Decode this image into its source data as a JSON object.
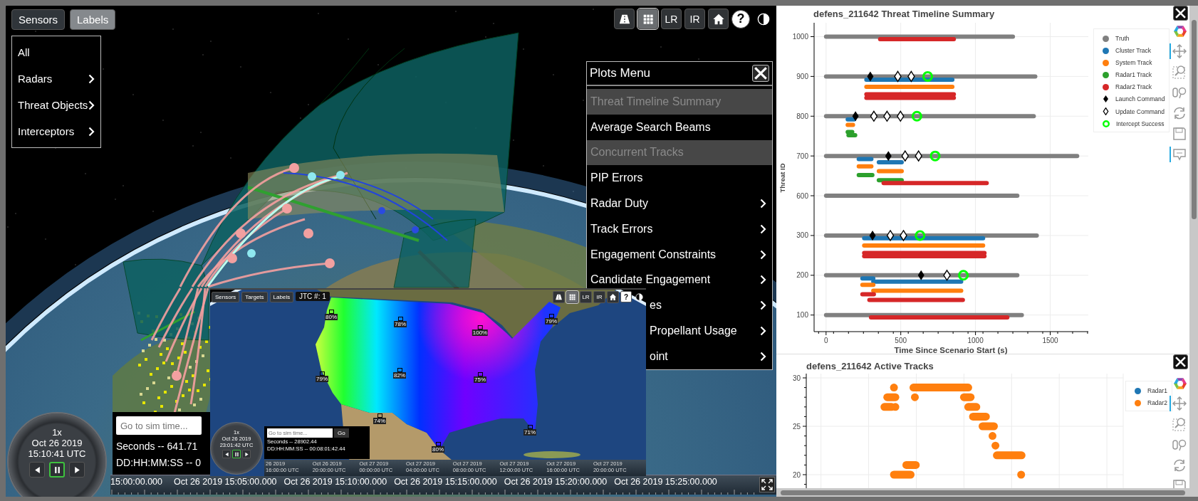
{
  "viewer": {
    "top_buttons": [
      {
        "label": "Sensors",
        "selected": false
      },
      {
        "label": "Labels",
        "selected": true
      }
    ],
    "labels_menu": [
      {
        "label": "All",
        "submenu": false
      },
      {
        "label": "Radars",
        "submenu": true
      },
      {
        "label": "Threat Objects",
        "submenu": true
      },
      {
        "label": "Interceptors",
        "submenu": true
      }
    ],
    "toolbar": [
      {
        "kind": "road",
        "selected": false
      },
      {
        "kind": "grid",
        "selected": true
      },
      {
        "kind": "text",
        "label": "LR",
        "selected": false
      },
      {
        "kind": "text",
        "label": "IR",
        "selected": false
      },
      {
        "kind": "home",
        "selected": false
      },
      {
        "kind": "round-text",
        "label": "?",
        "selected": false
      },
      {
        "kind": "contrast",
        "selected": false
      }
    ],
    "plots_menu": {
      "title": "Plots Menu",
      "items": [
        {
          "label": "Threat Timeline Summary",
          "disabled": true,
          "submenu": false,
          "covered": false
        },
        {
          "label": "Average Search Beams",
          "disabled": false,
          "submenu": false,
          "covered": false
        },
        {
          "label": "Concurrent Tracks",
          "disabled": true,
          "submenu": false,
          "covered": false
        },
        {
          "label": "PIP Errors",
          "disabled": false,
          "submenu": false,
          "covered": false
        },
        {
          "label": "Radar Duty",
          "disabled": false,
          "submenu": true,
          "covered": false
        },
        {
          "label": "Track Errors",
          "disabled": false,
          "submenu": true,
          "covered": false
        },
        {
          "label": "Engagement Constraints",
          "disabled": false,
          "submenu": true,
          "covered": false
        },
        {
          "label": "Candidate Engagement",
          "disabled": false,
          "submenu": true,
          "covered": false
        },
        {
          "label": "es",
          "disabled": false,
          "submenu": true,
          "covered": true
        },
        {
          "label": "Propellant Usage",
          "disabled": false,
          "submenu": true,
          "covered": true
        },
        {
          "label": "oint",
          "disabled": false,
          "submenu": true,
          "covered": true
        }
      ]
    },
    "clock": {
      "speed": "1x",
      "date": "Oct 26 2019",
      "time": "15:10:41 UTC",
      "controls": [
        {
          "kind": "back",
          "selected": false
        },
        {
          "kind": "pause",
          "selected": true
        },
        {
          "kind": "forward",
          "selected": false
        }
      ]
    },
    "sim_time": {
      "placeholder": "Go to sim time...",
      "seconds": "Seconds -- 641.71",
      "dhms": "DD:HH:MM:SS -- 0"
    },
    "timeline": {
      "labels": [
        "15:00:00.000",
        "Oct 26 2019 15:05:00.000",
        "Oct 26 2019 15:10:00.000",
        "Oct 26 2019 15:15:00.000",
        "Oct 26 2019 15:20:00.000",
        "Oct 26 2019 15:25:00.000"
      ]
    },
    "inset": {
      "buttons": [
        {
          "label": "Sensors",
          "selected": false
        },
        {
          "label": "Targets",
          "selected": false
        },
        {
          "label": "Labels",
          "selected": false
        }
      ],
      "jtc": "JTC #: 1",
      "toolbar": [
        {
          "kind": "road",
          "selected": false
        },
        {
          "kind": "grid",
          "selected": true
        },
        {
          "kind": "text",
          "label": "LR",
          "selected": false
        },
        {
          "kind": "text",
          "label": "IR",
          "selected": false
        },
        {
          "kind": "home",
          "selected": false
        },
        {
          "kind": "round-text",
          "label": "?",
          "selected": false
        },
        {
          "kind": "contrast",
          "selected": false
        }
      ],
      "coverage_labels": [
        "80%",
        "78%",
        "100%",
        "79%",
        "79%",
        "82%",
        "75%",
        "74%",
        "71%",
        "80%"
      ],
      "clock": {
        "speed": "1x",
        "date": "Oct 26 2019",
        "time": "23:01:42 UTC",
        "controls": [
          {
            "kind": "back",
            "selected": false
          },
          {
            "kind": "pause",
            "selected": true
          },
          {
            "kind": "forward",
            "selected": false
          }
        ]
      },
      "sim_time": {
        "placeholder": "Go to sim time...",
        "button": "Go",
        "seconds": "Seconds -- 28902.44",
        "dhms": "DD:HH:MM:SS -- 00:08:01:42.44"
      },
      "timeline": {
        "labels": [
          "26 2019 16:00:00 UTC",
          "Oct 26 2019 20:00:00 UTC",
          "Oct 27 2019 00:00:00 UTC",
          "Oct 27 2019 04:00:00 UTC",
          "Oct 27 2019 08:00:00 UTC",
          "Oct 27 2019 12:00:00 UTC",
          "Oct 27 2019 16:00:00 UTC",
          "Oct 27 2019 20:00:00 UTC"
        ]
      }
    }
  },
  "threat_timeline": {
    "title": "defens_211642 Threat Timeline Summary",
    "y_title": "Threat ID",
    "x_title": "Time Since Scenario Start (s)",
    "y_ticks": [
      "1000",
      "900",
      "800",
      "700",
      "600",
      "300",
      "200",
      "100"
    ],
    "x_ticks": [
      "0",
      "500",
      "1000",
      "1500"
    ],
    "legend": [
      {
        "label": "Truth",
        "kind": "dot",
        "color": "#808080"
      },
      {
        "label": "Cluster Track",
        "kind": "dot",
        "color": "#1f77b4"
      },
      {
        "label": "System Track",
        "kind": "dot",
        "color": "#ff7f0e"
      },
      {
        "label": "Radar1 Track",
        "kind": "dot",
        "color": "#2ca02c"
      },
      {
        "label": "Radar2 Track",
        "kind": "dot",
        "color": "#d62728"
      },
      {
        "label": "Launch Command",
        "kind": "diamond",
        "color": "#000000"
      },
      {
        "label": "Update Command",
        "kind": "open-diamond",
        "color": "#000000"
      },
      {
        "label": "Intercept Success",
        "kind": "ring",
        "color": "#00ff00"
      }
    ],
    "tools": [
      {
        "kind": "pan",
        "active": true
      },
      {
        "kind": "box-zoom",
        "active": false
      },
      {
        "kind": "wheel-zoom",
        "active": false
      },
      {
        "kind": "reset",
        "active": false
      },
      {
        "kind": "save",
        "active": false
      },
      {
        "kind": "hover",
        "active": true
      }
    ]
  },
  "active_tracks": {
    "title": "defens_211642 Active Tracks",
    "y_ticks": [
      "30",
      "25",
      "20"
    ],
    "legend": [
      {
        "label": "Radar1",
        "kind": "dot",
        "color": "#1f77b4"
      },
      {
        "label": "Radar2",
        "kind": "dot",
        "color": "#ff7f0e"
      }
    ],
    "tools": [
      {
        "kind": "pan",
        "active": true
      },
      {
        "kind": "box-zoom",
        "active": false
      },
      {
        "kind": "wheel-zoom",
        "active": false
      },
      {
        "kind": "reset",
        "active": false
      },
      {
        "kind": "save",
        "active": false
      }
    ]
  }
}
